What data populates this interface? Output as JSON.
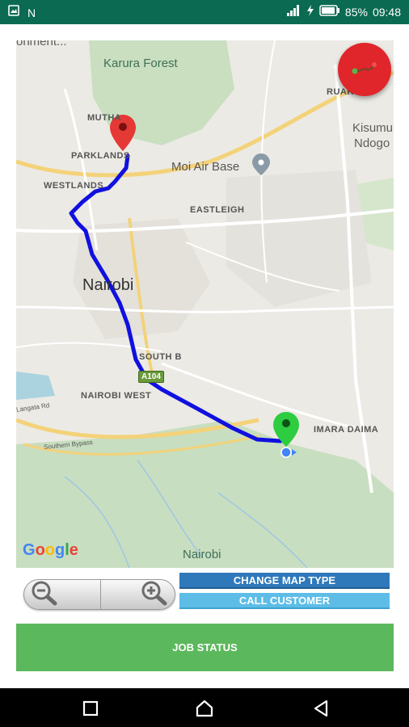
{
  "status_bar": {
    "app_icon": "image-icon",
    "notification_letter": "N",
    "battery_percent": "85%",
    "time": "09:48",
    "icons": [
      "signal-icon",
      "charging-bolt-icon",
      "battery-icon"
    ]
  },
  "map": {
    "labels": {
      "environment_partial": "onment...",
      "karura_forest": "Karura Forest",
      "muthaiga": "MUTHA",
      "parklands": "PARKLANDS",
      "moi_air_base": "Moi Air Base",
      "westlands": "WESTLANDS",
      "eastleigh": "EASTLEIGH",
      "nairobi": "Nairobi",
      "south_b": "SOUTH B",
      "nairobi_west": "NAIROBI WEST",
      "imara_daima": "IMARA DAIMA",
      "kisumu": "Kisumu",
      "ndogo": "Ndogo",
      "ruaka": "RUAR",
      "langata_rd": "Langata Rd",
      "southern_bypass": "Southern Bypass",
      "nairobi_national_park": "Nairobi",
      "a104": "A104"
    },
    "attribution": "Google",
    "route_color": "#1010e0",
    "origin_marker_color": "#2ecc40",
    "destination_marker_color": "#e53935"
  },
  "fab": {
    "icon": "route-icon",
    "color": "#e0262a"
  },
  "zoom": {
    "out_icon": "zoom-out-icon",
    "in_icon": "zoom-in-icon"
  },
  "buttons": {
    "change_map_type": "CHANGE MAP TYPE",
    "call_customer": "CALL CUSTOMER",
    "job_status": "JOB STATUS"
  },
  "colors": {
    "status_bar": "#0b6a52",
    "change_map_type": "#2f79bb",
    "call_customer": "#5dbde7",
    "job_status": "#5cb85c"
  }
}
